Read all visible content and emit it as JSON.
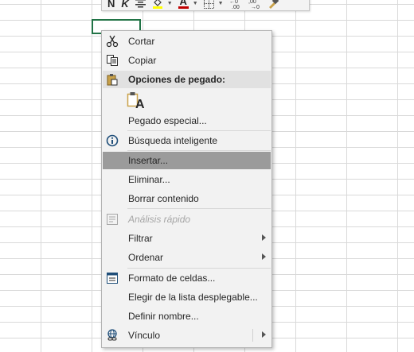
{
  "toolbar": {
    "bold": "N",
    "italic": "K",
    "font_color_letter": "A"
  },
  "menu": {
    "cortar": "Cortar",
    "copiar": "Copiar",
    "opciones_pegado": "Opciones de pegado:",
    "paste_option_letter": "A",
    "pegado_especial": "Pegado especial...",
    "busqueda_inteligente": "Búsqueda inteligente",
    "insertar": "Insertar...",
    "eliminar": "Eliminar...",
    "borrar_contenido": "Borrar contenido",
    "analisis_rapido": "Análisis rápido",
    "filtrar": "Filtrar",
    "ordenar": "Ordenar",
    "formato_celdas": "Formato de celdas...",
    "elegir_lista": "Elegir de la lista desplegable...",
    "definir_nombre": "Definir nombre...",
    "vinculo": "Vínculo"
  },
  "colors": {
    "highlight": "#9b9b9b",
    "active_cell_border": "#217346",
    "font_color_red": "#c00000",
    "fill_yellow": "#ffff00"
  },
  "icons": [
    "scissors-icon",
    "copy-icon",
    "paste-icon",
    "paste-keep-text-icon",
    "smart-lookup-icon",
    "quick-analysis-icon",
    "format-cells-icon",
    "link-icon"
  ]
}
